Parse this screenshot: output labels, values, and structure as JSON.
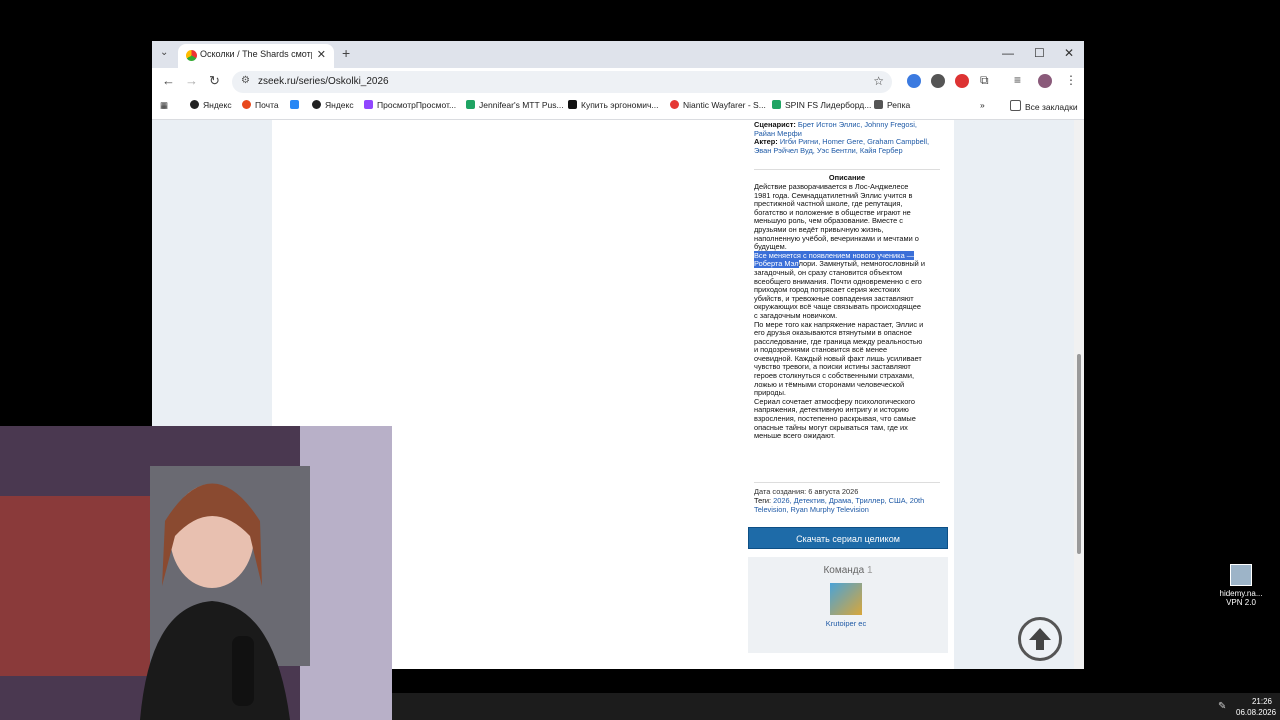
{
  "browser": {
    "tab_title": "Осколки / The Shards смотреть",
    "url": "zseek.ru/series/Oskolki_2026",
    "bookmarks": [
      "Яндекс",
      "Почта",
      "Яндекс",
      "ПросмотрПросмот...",
      "Jennifear's MTT Pus...",
      "Купить эргономич...",
      "Niantic Wayfarer - S...",
      "SPIN FS Лидерборд...",
      "Репка"
    ],
    "all_bookmarks": "Все закладки"
  },
  "details": {
    "writer_label": "Сценарист:",
    "writer_links": "Брет Истон Эллис, Johnny Fregosi, Райан Мерфи",
    "actor_label": "Актер:",
    "actor_links": "Игби Ригни, Homer Gere, Graham Campbell, Эван Рэйчел Вуд, Уэс Бентли, Кайя Гербер",
    "desc_heading": "Описание",
    "desc_p1": "Действие разворачивается в Лос-Анджелесе 1981 года. Семнадцатилетний Эллис учится в престижной частной школе, где репутация, богатство и положение в обществе играют не меньшую роль, чем образование. Вместе с друзьями он ведёт привычную жизнь, наполненную учёбой, вечеринками и мечтами о будущем.",
    "desc_highlight": "Все меняется с появлением нового ученика — Роберта Мэл",
    "desc_p2": "лори. Замкнутый, немногословный и загадочный, он сразу становится объектом всеобщего внимания. Почти одновременно с его приходом город потрясает серия жестоких убийств, и тревожные совпадения заставляют окружающих всё чаще связывать происходящее с загадочным новичком.",
    "desc_p3": "По мере того как напряжение нарастает, Эллис и его друзья оказываются втянутыми в опасное расследование, где граница между реальностью и подозрениями становится всё менее очевидной. Каждый новый факт лишь усиливает чувство тревоги, а поиски истины заставляют героев столкнуться с собственными страхами, ложью и тёмными сторонами человеческой природы.",
    "desc_p4": "Сериал сочетает атмосферу психологического напряжения, детективную интригу и историю взросления, постепенно раскрывая, что самые опасные тайны могут скрываться там, где их меньше всего ожидают.",
    "created_label": "Дата создания: 6 августа 2026",
    "tags_label": "Теги:",
    "tags_links": "2026, Детектив, Драма, Триллер, США, 20th Television, Ryan Murphy Television",
    "download_button": "Скачать сериал целиком",
    "team_label": "Команда",
    "team_count": "1",
    "member_name": "Krutoiper ec"
  },
  "desktop": {
    "vpn_icon_label": "hidemy.na... VPN 2.0",
    "clock_time": "21:26",
    "clock_date": "06.08.2026"
  },
  "colors": {
    "accent": "#1e6ba8",
    "link": "#1f5aa6",
    "highlight": "#3b6fd8"
  }
}
